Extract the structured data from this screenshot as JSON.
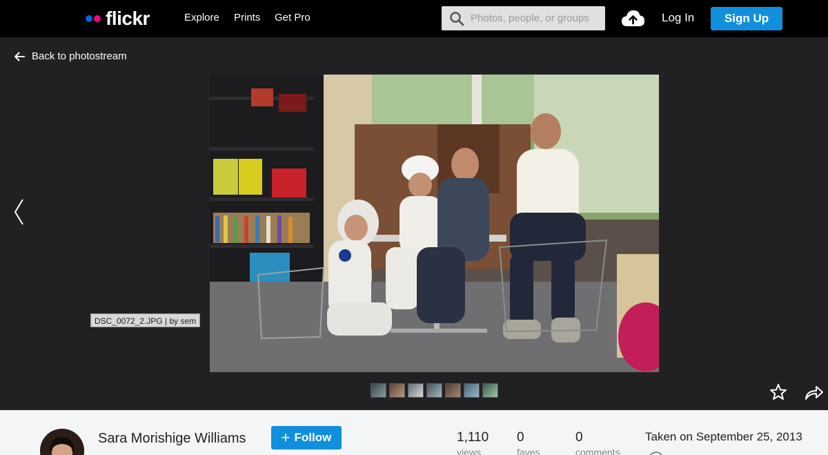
{
  "header": {
    "logo_text": "flickr",
    "nav": [
      "Explore",
      "Prints",
      "Get Pro"
    ],
    "search_placeholder": "Photos, people, or groups",
    "login_label": "Log In",
    "signup_label": "Sign Up"
  },
  "viewer": {
    "back_label": "Back to photostream",
    "image_tooltip": "DSC_0072_2.JPG | by sem",
    "filmstrip_count": 7
  },
  "info": {
    "owner_name": "Sara Morishige Williams",
    "follow_label": "Follow",
    "stats": [
      {
        "value": "1,110",
        "label": "views"
      },
      {
        "value": "0",
        "label": "faves"
      },
      {
        "value": "0",
        "label": "comments"
      }
    ],
    "taken": "Taken on September 25, 2013"
  },
  "colors": {
    "accent_blue": "#128fdc",
    "logo_blue": "#0063dc",
    "logo_pink": "#ff0084"
  },
  "icons": [
    "search-icon",
    "upload-cloud-icon",
    "arrow-left-icon",
    "chevron-left-icon",
    "star-icon",
    "share-arrow-icon",
    "plus-icon"
  ]
}
